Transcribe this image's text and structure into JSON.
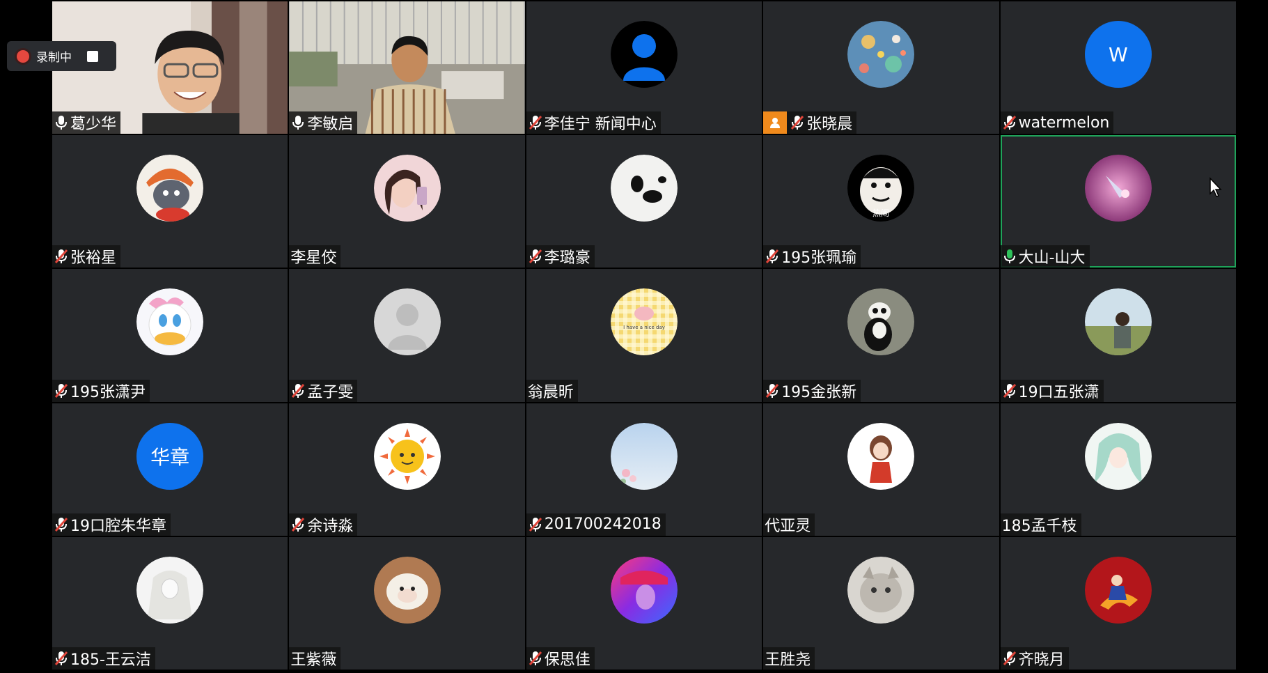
{
  "recording": {
    "label": "录制中"
  },
  "participants": [
    {
      "name": "葛少华",
      "mic": "on",
      "kind": "video"
    },
    {
      "name": "李敏启",
      "mic": "on",
      "kind": "video"
    },
    {
      "name": "李佳宁 新闻中心",
      "mic": "muted",
      "kind": "avatar",
      "avatar": "default-person"
    },
    {
      "name": "张晓晨",
      "mic": "muted",
      "kind": "avatar",
      "avatar": "space-pattern",
      "badge": "user-badge"
    },
    {
      "name": "watermelon",
      "mic": "muted",
      "kind": "avatar",
      "avatar": "letter",
      "initial": "W"
    },
    {
      "name": "张裕星",
      "mic": "muted",
      "kind": "avatar",
      "avatar": "cartoon-cat"
    },
    {
      "name": "李星佼",
      "mic": "none",
      "kind": "avatar",
      "avatar": "girl-photo"
    },
    {
      "name": "李璐豪",
      "mic": "muted",
      "kind": "avatar",
      "avatar": "panda-sketch"
    },
    {
      "name": "195张珮瑜",
      "mic": "muted",
      "kind": "avatar",
      "avatar": "meme-face",
      "avatar_text": "热闹"
    },
    {
      "name": "大山-山大",
      "mic": "speaking",
      "kind": "avatar",
      "avatar": "pink-photo",
      "active": true
    },
    {
      "name": "195张潇尹",
      "mic": "muted",
      "kind": "avatar",
      "avatar": "daisy-duck"
    },
    {
      "name": "孟子雯",
      "mic": "muted",
      "kind": "avatar",
      "avatar": "default-gray"
    },
    {
      "name": "翁晨昕",
      "mic": "none",
      "kind": "avatar",
      "avatar": "gingham-pig",
      "avatar_text": "I have a nice day"
    },
    {
      "name": "195金张新",
      "mic": "muted",
      "kind": "avatar",
      "avatar": "panda-photo"
    },
    {
      "name": "19口五张潇",
      "mic": "muted",
      "kind": "avatar",
      "avatar": "field-photo"
    },
    {
      "name": "19口腔朱华章",
      "mic": "muted",
      "kind": "avatar",
      "avatar": "letter",
      "initial": "华章"
    },
    {
      "name": "余诗淼",
      "mic": "muted",
      "kind": "avatar",
      "avatar": "sun-cartoon"
    },
    {
      "name": "201700242018",
      "mic": "muted",
      "kind": "avatar",
      "avatar": "sky-photo"
    },
    {
      "name": "代亚灵",
      "mic": "none",
      "kind": "avatar",
      "avatar": "anime-girl"
    },
    {
      "name": "185孟千枝",
      "mic": "none",
      "kind": "avatar",
      "avatar": "anime-teal"
    },
    {
      "name": "185-王云洁",
      "mic": "muted",
      "kind": "avatar",
      "avatar": "bride-sketch"
    },
    {
      "name": "王紫薇",
      "mic": "none",
      "kind": "avatar",
      "avatar": "sheep-plush"
    },
    {
      "name": "保思佳",
      "mic": "muted",
      "kind": "avatar",
      "avatar": "neon-photo"
    },
    {
      "name": "王胜尧",
      "mic": "none",
      "kind": "avatar",
      "avatar": "cat-photo"
    },
    {
      "name": "齐晓月",
      "mic": "muted",
      "kind": "avatar",
      "avatar": "red-cartoon"
    }
  ],
  "colors": {
    "tile": "#26282b",
    "active_border": "#1fa35a",
    "record_dot": "#e5483f",
    "muted_mic": "#e0453a",
    "speaking_mic": "#2fc25b",
    "zoom_blue": "#0e72ed"
  }
}
